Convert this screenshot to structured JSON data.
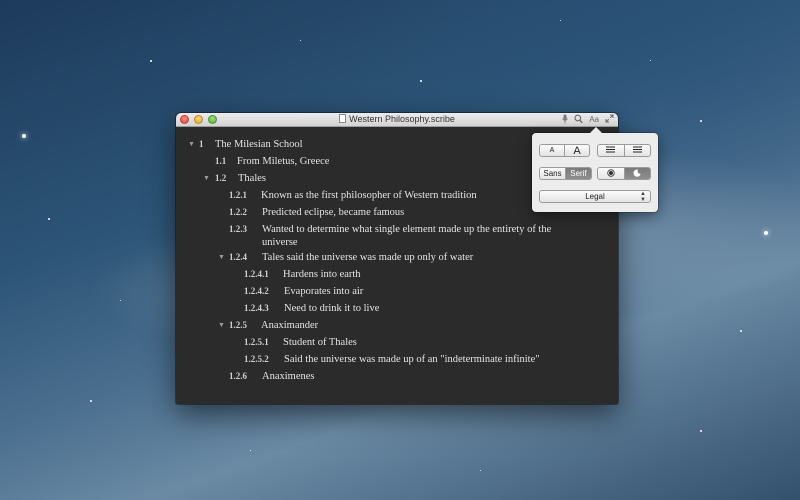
{
  "window": {
    "title": "Western Philosophy.scribe",
    "toolbar_icons": [
      "microphone-icon",
      "search-icon",
      "font-icon",
      "fullscreen-icon"
    ],
    "font_icon_label": "Aa"
  },
  "outline": [
    {
      "num": "1",
      "text": "The Milesian School",
      "triangle": "▼"
    },
    {
      "num": "1.1",
      "text": "From Miletus, Greece"
    },
    {
      "num": "1.2",
      "text": "Thales",
      "triangle": "▼"
    },
    {
      "num": "1.2.1",
      "text": "Known as the first philosopher of Western tradition"
    },
    {
      "num": "1.2.2",
      "text": "Predicted eclipse, became famous"
    },
    {
      "num": "1.2.3",
      "text": "Wanted to determine what single element made up the entirety of the universe"
    },
    {
      "num": "1.2.4",
      "text": "Tales said the universe was made up only of water",
      "triangle": "▼"
    },
    {
      "num": "1.2.4.1",
      "text": "Hardens into earth"
    },
    {
      "num": "1.2.4.2",
      "text": "Evaporates into air"
    },
    {
      "num": "1.2.4.3",
      "text": "Need to drink it to live"
    },
    {
      "num": "1.2.5",
      "text": "Anaximander",
      "triangle": "▼"
    },
    {
      "num": "1.2.5.1",
      "text": "Student of Thales"
    },
    {
      "num": "1.2.5.2",
      "text": "Said the universe was made up of an \"indeterminate infinite\""
    },
    {
      "num": "1.2.6",
      "text": "Anaximenes"
    }
  ],
  "popover": {
    "size_small": "A",
    "size_large": "A",
    "font_sans": "Sans",
    "font_serif": "Serif",
    "selected_font": "Serif",
    "selected_theme": "dark",
    "paper_size": "Legal"
  }
}
